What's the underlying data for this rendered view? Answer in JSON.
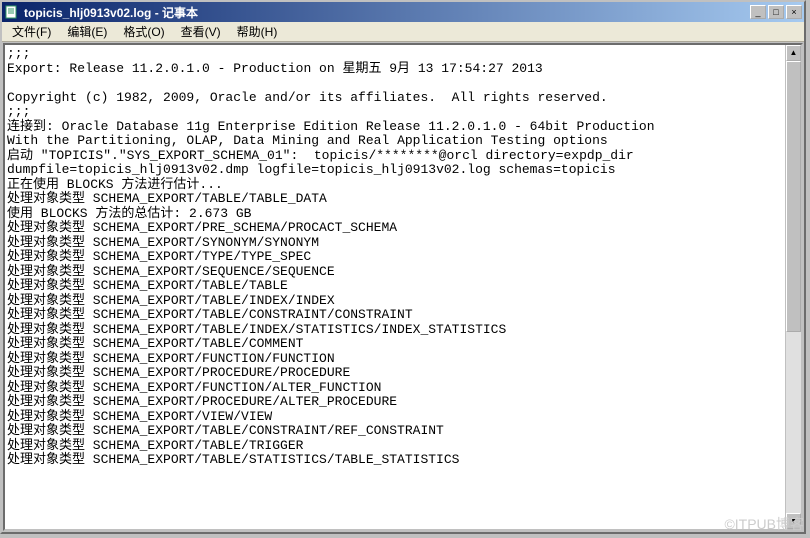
{
  "window": {
    "title": "topicis_hlj0913v02.log - 记事本"
  },
  "menu": {
    "file": "文件(F)",
    "edit": "编辑(E)",
    "format": "格式(O)",
    "view": "查看(V)",
    "help": "帮助(H)"
  },
  "titlebar_buttons": {
    "min": "_",
    "max": "□",
    "close": "×"
  },
  "scroll": {
    "up": "▲",
    "down": "▼"
  },
  "watermark": "©ITPUB博客",
  "log": {
    "lines": [
      ";;;",
      "Export: Release 11.2.0.1.0 - Production on 星期五 9月 13 17:54:27 2013",
      "",
      "Copyright (c) 1982, 2009, Oracle and/or its affiliates.  All rights reserved.",
      ";;;",
      "连接到: Oracle Database 11g Enterprise Edition Release 11.2.0.1.0 - 64bit Production",
      "With the Partitioning, OLAP, Data Mining and Real Application Testing options",
      "启动 \"TOPICIS\".\"SYS_EXPORT_SCHEMA_01\":  topicis/********@orcl directory=expdp_dir",
      "dumpfile=topicis_hlj0913v02.dmp logfile=topicis_hlj0913v02.log schemas=topicis",
      "正在使用 BLOCKS 方法进行估计...",
      "处理对象类型 SCHEMA_EXPORT/TABLE/TABLE_DATA",
      "使用 BLOCKS 方法的总估计: 2.673 GB",
      "处理对象类型 SCHEMA_EXPORT/PRE_SCHEMA/PROCACT_SCHEMA",
      "处理对象类型 SCHEMA_EXPORT/SYNONYM/SYNONYM",
      "处理对象类型 SCHEMA_EXPORT/TYPE/TYPE_SPEC",
      "处理对象类型 SCHEMA_EXPORT/SEQUENCE/SEQUENCE",
      "处理对象类型 SCHEMA_EXPORT/TABLE/TABLE",
      "处理对象类型 SCHEMA_EXPORT/TABLE/INDEX/INDEX",
      "处理对象类型 SCHEMA_EXPORT/TABLE/CONSTRAINT/CONSTRAINT",
      "处理对象类型 SCHEMA_EXPORT/TABLE/INDEX/STATISTICS/INDEX_STATISTICS",
      "处理对象类型 SCHEMA_EXPORT/TABLE/COMMENT",
      "处理对象类型 SCHEMA_EXPORT/FUNCTION/FUNCTION",
      "处理对象类型 SCHEMA_EXPORT/PROCEDURE/PROCEDURE",
      "处理对象类型 SCHEMA_EXPORT/FUNCTION/ALTER_FUNCTION",
      "处理对象类型 SCHEMA_EXPORT/PROCEDURE/ALTER_PROCEDURE",
      "处理对象类型 SCHEMA_EXPORT/VIEW/VIEW",
      "处理对象类型 SCHEMA_EXPORT/TABLE/CONSTRAINT/REF_CONSTRAINT",
      "处理对象类型 SCHEMA_EXPORT/TABLE/TRIGGER",
      "处理对象类型 SCHEMA_EXPORT/TABLE/STATISTICS/TABLE_STATISTICS"
    ]
  }
}
